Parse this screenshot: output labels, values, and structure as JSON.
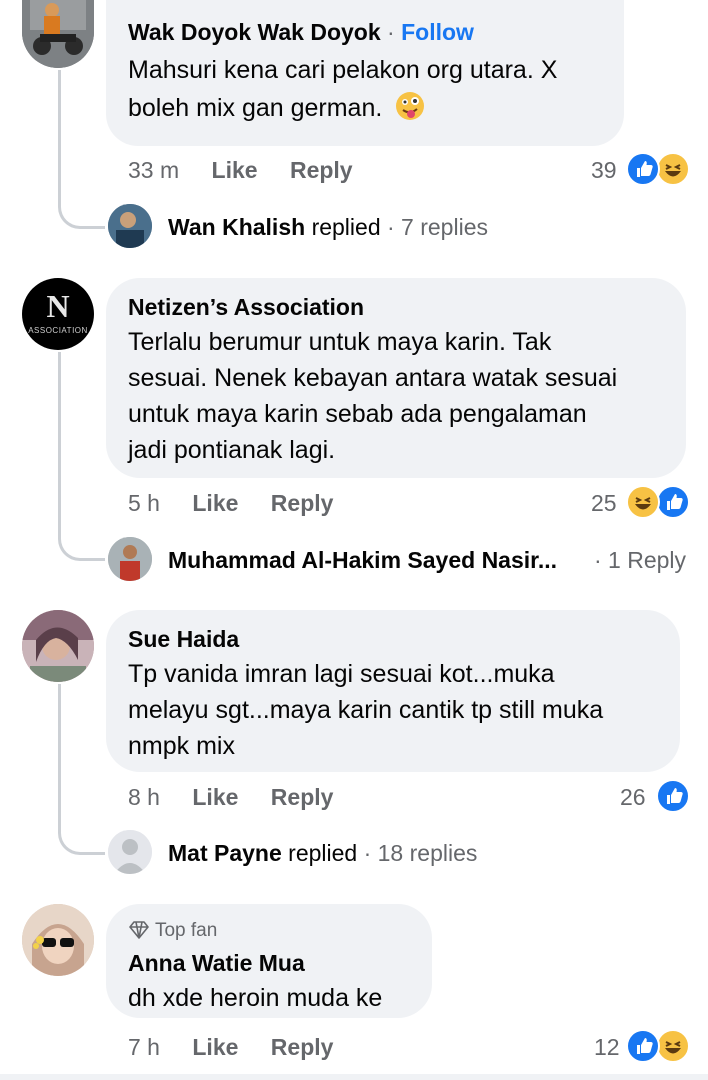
{
  "comments": [
    {
      "name": "Wak Doyok Wak Doyok",
      "follow": "Follow",
      "text_line1": "Mahsuri kena cari pelakon org utara. X",
      "text_line2": "boleh mix gan german.",
      "time": "33 m",
      "like": "Like",
      "reply": "Reply",
      "count": "39",
      "reply_preview": {
        "name": "Wan Khalish",
        "verb": "replied",
        "count": "· 7 replies"
      }
    },
    {
      "name": "Netizen’s Association",
      "avatar_letter": "N",
      "avatar_word": "ASSOCIATION",
      "text_lines": [
        "Terlalu berumur untuk maya karin. Tak",
        "sesuai. Nenek kebayan antara watak sesuai",
        "untuk maya karin sebab ada pengalaman",
        "jadi pontianak lagi."
      ],
      "time": "5 h",
      "like": "Like",
      "reply": "Reply",
      "count": "25",
      "reply_preview": {
        "name": "Muhammad Al-Hakim Sayed Nasir...",
        "count": "· 1 Reply"
      }
    },
    {
      "name": "Sue Haida",
      "text_lines": [
        "Tp vanida imran lagi sesuai kot...muka",
        "melayu sgt...maya karin cantik tp still muka",
        "nmpk mix"
      ],
      "time": "8 h",
      "like": "Like",
      "reply": "Reply",
      "count": "26",
      "reply_preview": {
        "name": "Mat Payne",
        "verb": "replied",
        "count": "· 18 replies"
      }
    },
    {
      "badge": "Top fan",
      "name": "Anna Watie Mua",
      "text": "dh xde heroin muda ke",
      "time": "7 h",
      "like": "Like",
      "reply": "Reply",
      "count": "12"
    }
  ],
  "colors": {
    "accent": "#1877f2",
    "bubble": "#f0f2f5",
    "meta": "#65676b",
    "haha": "#f7c244"
  },
  "icons": [
    "like-reaction-icon",
    "haha-reaction-icon",
    "diamond-icon",
    "tongue-emoji-icon"
  ]
}
